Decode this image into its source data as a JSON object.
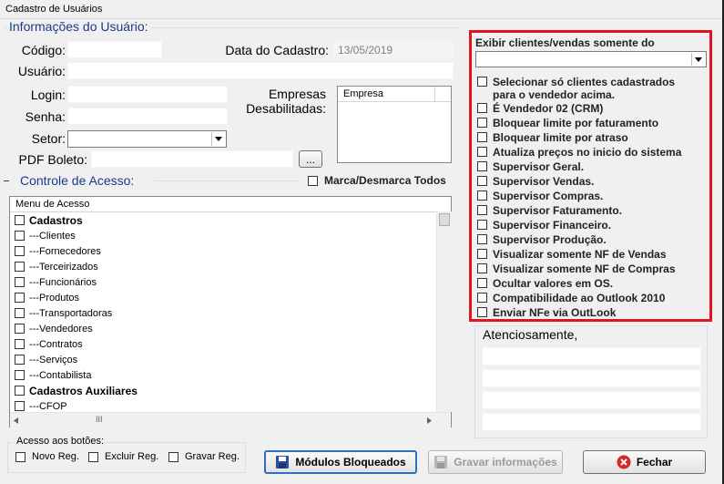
{
  "window": {
    "title": "Cadastro de Usuários"
  },
  "user_info": {
    "section_title": "Informações do Usuário:",
    "codigo_label": "Código:",
    "codigo_value": "",
    "data_cadastro_label": "Data do Cadastro:",
    "data_cadastro_value": "13/05/2019",
    "usuario_label": "Usuário:",
    "usuario_value": "",
    "login_label": "Login:",
    "login_value": "",
    "senha_label": "Senha:",
    "senha_value": "",
    "setor_label": "Setor:",
    "setor_value": "",
    "pdf_boleto_label": "PDF Boleto:",
    "pdf_boleto_value": "",
    "browse_label": "...",
    "empresas_label_1": "Empresas",
    "empresas_label_2": "Desabilitadas:",
    "empresas_column": "Empresa"
  },
  "access_control": {
    "section_title": "Controle de Acesso:",
    "toggle_all_label": "Marca/Desmarca Todos",
    "column_header": "Menu de Acesso",
    "items": [
      {
        "label": "Cadastros",
        "bold": true
      },
      {
        "label": "---Clientes",
        "bold": false
      },
      {
        "label": "---Fornecedores",
        "bold": false
      },
      {
        "label": "---Terceirizados",
        "bold": false
      },
      {
        "label": "---Funcionários",
        "bold": false
      },
      {
        "label": "---Produtos",
        "bold": false
      },
      {
        "label": "---Transportadoras",
        "bold": false
      },
      {
        "label": "---Vendedores",
        "bold": false
      },
      {
        "label": "---Contratos",
        "bold": false
      },
      {
        "label": "---Serviços",
        "bold": false
      },
      {
        "label": "---Contabilista",
        "bold": false
      },
      {
        "label": "Cadastros Auxiliares",
        "bold": true
      },
      {
        "label": "---CFOP",
        "bold": false
      }
    ],
    "hscroll_grip": "III"
  },
  "button_access": {
    "group_title": "Acesso aos botões:",
    "novo_label": "Novo Reg.",
    "excluir_label": "Excluir Reg.",
    "gravar_label": "Gravar Reg."
  },
  "options": {
    "vendedor_label": "Exibir clientes/vendas somente do vendedor:",
    "vendedor_value": "",
    "items": [
      {
        "label": "Selecionar só clientes cadastrados",
        "label2": "para o vendedor acima."
      },
      {
        "label": "É Vendedor 02 (CRM)"
      },
      {
        "label": "Bloquear limite por faturamento"
      },
      {
        "label": "Bloquear limite por atraso"
      },
      {
        "label": "Atualiza preços no inicio do sistema"
      },
      {
        "label": "Supervisor Geral."
      },
      {
        "label": "Supervisor Vendas."
      },
      {
        "label": "Supervisor Compras."
      },
      {
        "label": "Supervisor Faturamento."
      },
      {
        "label": "Supervisor Financeiro."
      },
      {
        "label": "Supervisor Produção."
      },
      {
        "label": "Visualizar somente NF de Vendas"
      },
      {
        "label": "Visualizar somente NF de Compras"
      },
      {
        "label": "Ocultar valores em OS."
      },
      {
        "label": "Compatibilidade ao Outlook 2010"
      },
      {
        "label": "Enviar NFe via OutLook"
      }
    ]
  },
  "signature": {
    "label": "Atenciosamente,"
  },
  "buttons": {
    "modulos_label": "Módulos Bloqueados",
    "gravar_label": "Gravar informações",
    "fechar_label": "Fechar"
  },
  "colors": {
    "accent_red": "#e0141e",
    "section_blue": "#1c3a8c"
  }
}
